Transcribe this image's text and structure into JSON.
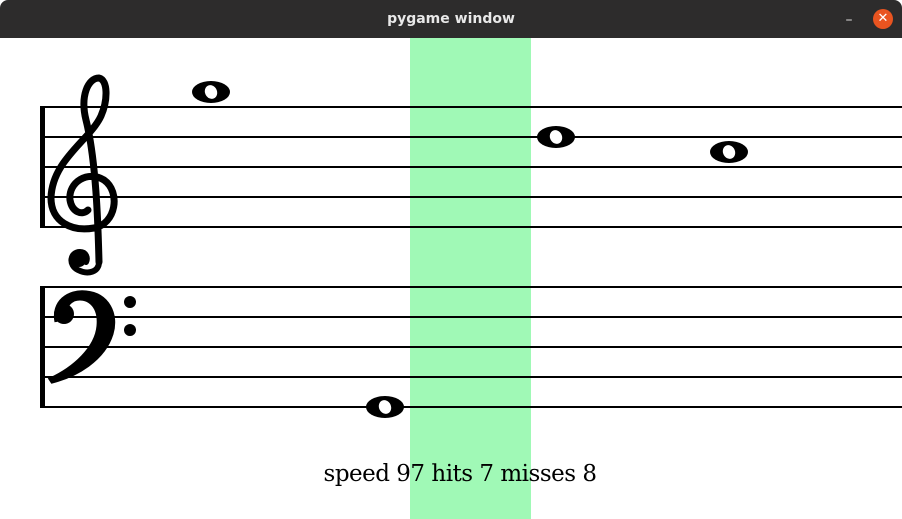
{
  "window": {
    "title": "pygame window",
    "minimize_icon": "minimize-icon",
    "close_icon": "close-icon",
    "close_color": "#e95420"
  },
  "game": {
    "hit_zone_color": "#a0f9b6",
    "clefs": [
      "treble-clef-icon",
      "bass-clef-icon"
    ],
    "status": {
      "speed": 97,
      "hits": 7,
      "misses": 8,
      "text": "speed 97 hits 7 misses 8"
    }
  }
}
